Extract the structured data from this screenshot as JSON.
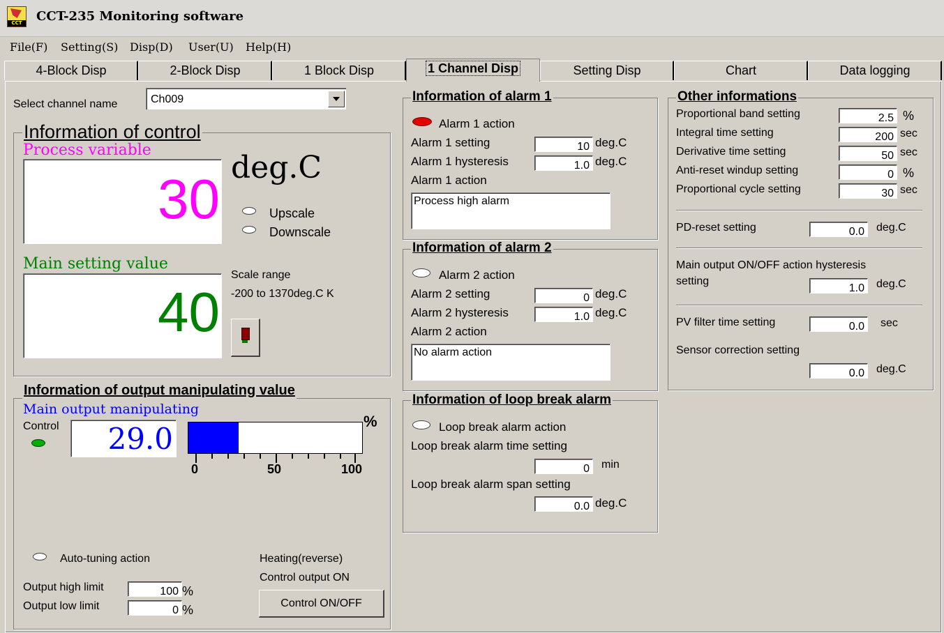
{
  "window": {
    "title": "CCT-235 Monitoring software",
    "icon_text": "CCT"
  },
  "menu": [
    "File(F)",
    "Setting(S)",
    "Disp(D)",
    "User(U)",
    "Help(H)"
  ],
  "tabs": [
    "4-Block Disp",
    "2-Block Disp",
    "1 Block Disp",
    "1 Channel Disp",
    "Setting Disp",
    "Chart",
    "Data logging"
  ],
  "active_tab": "1 Channel Disp",
  "channel": {
    "label": "Select channel name",
    "value": "Ch009"
  },
  "control": {
    "title": "Information of control",
    "pv_label": "Process variable",
    "pv_value": "30",
    "unit": "deg.C",
    "upscale": "Upscale",
    "downscale": "Downscale",
    "sv_label": "Main setting value",
    "sv_value": "40",
    "scale_label": "Scale range",
    "scale_value": "-200 to 1370deg.C K"
  },
  "output": {
    "title": "Information of output manipulating value",
    "mv_label": "Main output manipulating",
    "control_label": "Control",
    "mv_value": "29.0",
    "bar_percent": 29,
    "percent_sign": "%",
    "ticks": [
      "0",
      "50",
      "100"
    ],
    "autotuning": "Auto-tuning action",
    "heating": "Heating(reverse)",
    "control_output": "Control output ON",
    "high_limit_label": "Output high limit",
    "high_limit_value": "100",
    "low_limit_label": "Output low limit",
    "low_limit_value": "0",
    "pct": "%",
    "button": "Control ON/OFF"
  },
  "alarm1": {
    "title": "Information of alarm 1",
    "action_indicator": "Alarm 1 action",
    "setting_label": "Alarm 1 setting",
    "setting_value": "10",
    "hyst_label": "Alarm 1 hysteresis",
    "hyst_value": "1.0",
    "action_label": "Alarm 1 action",
    "action_value": "Process high alarm",
    "unit": "deg.C"
  },
  "alarm2": {
    "title": "Information of alarm 2",
    "action_indicator": "Alarm 2 action",
    "setting_label": "Alarm 2 setting",
    "setting_value": "0",
    "hyst_label": "Alarm 2 hysteresis",
    "hyst_value": "1.0",
    "action_label": "Alarm 2 action",
    "action_value": "No alarm action",
    "unit": "deg.C"
  },
  "loopbreak": {
    "title": "Information of loop break alarm",
    "action_indicator": "Loop break alarm action",
    "time_label": "Loop break alarm time setting",
    "time_value": "0",
    "time_unit": "min",
    "span_label": "Loop break alarm span setting",
    "span_value": "0.0",
    "span_unit": "deg.C"
  },
  "other": {
    "title": "Other informations",
    "rows": [
      {
        "label": "Proportional band setting",
        "value": "2.5",
        "unit": "%"
      },
      {
        "label": "Integral time setting",
        "value": "200",
        "unit": "sec"
      },
      {
        "label": "Derivative time setting",
        "value": "50",
        "unit": "sec"
      },
      {
        "label": "Anti-reset windup setting",
        "value": "0",
        "unit": "%"
      },
      {
        "label": "Proportional cycle setting",
        "value": "30",
        "unit": "sec"
      }
    ],
    "pd_label": "PD-reset setting",
    "pd_value": "0.0",
    "pd_unit": "deg.C",
    "hyst_label_1": "Main output ON/OFF action hysteresis",
    "hyst_label_2": "setting",
    "hyst_value": "1.0",
    "hyst_unit": "deg.C",
    "pvf_label": "PV filter time setting",
    "pvf_value": "0.0",
    "pvf_unit": "sec",
    "sensor_label": "Sensor correction setting",
    "sensor_value": "0.0",
    "sensor_unit": "deg.C"
  },
  "colors": {
    "pv": "#ff00ff",
    "sv": "#008000",
    "mv": "#0000ff",
    "bar": "#0000ff"
  }
}
